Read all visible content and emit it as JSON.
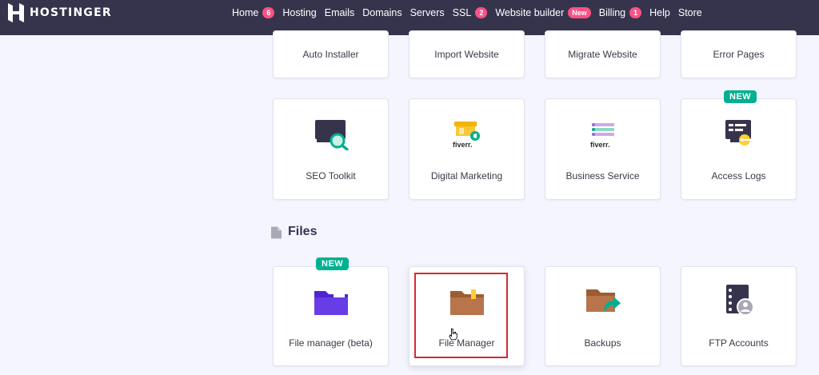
{
  "brand": {
    "name": "HOSTINGER"
  },
  "nav": [
    {
      "label": "Home",
      "badge": "6"
    },
    {
      "label": "Hosting"
    },
    {
      "label": "Emails"
    },
    {
      "label": "Domains"
    },
    {
      "label": "Servers"
    },
    {
      "label": "SSL",
      "badge": "2"
    },
    {
      "label": "Website builder",
      "badge": "New"
    },
    {
      "label": "Billing",
      "badge": "1"
    },
    {
      "label": "Help"
    },
    {
      "label": "Store"
    }
  ],
  "advanced_row": [
    {
      "label": "Auto Installer"
    },
    {
      "label": "Import Website"
    },
    {
      "label": "Migrate Website"
    },
    {
      "label": "Error Pages"
    }
  ],
  "marketing_row": [
    {
      "label": "SEO Toolkit",
      "icon": "seo-toolkit-icon"
    },
    {
      "label": "Digital Marketing",
      "icon": "fiverr-marketing-icon"
    },
    {
      "label": "Business Service",
      "icon": "fiverr-business-icon"
    },
    {
      "label": "Access Logs",
      "icon": "access-logs-icon",
      "tag": "NEW"
    }
  ],
  "files_section": {
    "title": "Files",
    "items": [
      {
        "label": "File manager (beta)",
        "icon": "folder-beta-icon",
        "tag": "NEW"
      },
      {
        "label": "File Manager",
        "icon": "folder-icon"
      },
      {
        "label": "Backups",
        "icon": "backups-icon"
      },
      {
        "label": "FTP Accounts",
        "icon": "ftp-accounts-icon"
      }
    ]
  },
  "fiverr_text": "fiverr.",
  "colors": {
    "nav_bg": "#36344d",
    "page_bg": "#f4f5ff",
    "badge": "#fc5185",
    "new_tag": "#00b090",
    "highlight": "#d42a33"
  }
}
